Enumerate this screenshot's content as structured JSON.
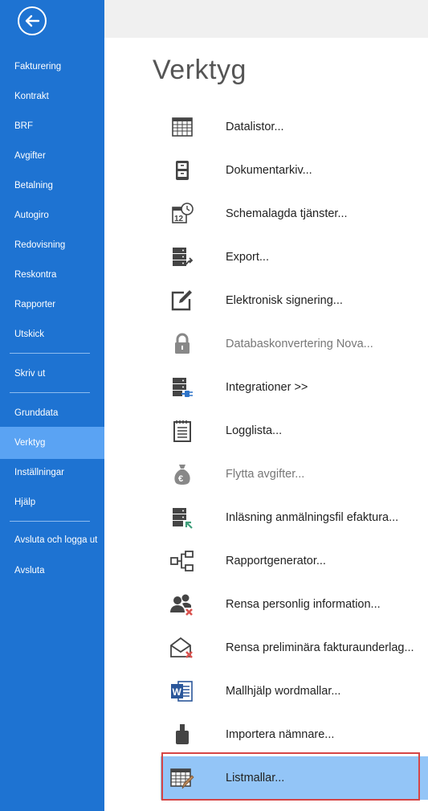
{
  "sidebar": {
    "back_icon": "arrow-left-circle-icon",
    "items": [
      {
        "label": "Fakturering"
      },
      {
        "label": "Kontrakt"
      },
      {
        "label": "BRF"
      },
      {
        "label": "Avgifter"
      },
      {
        "label": "Betalning"
      },
      {
        "label": "Autogiro"
      },
      {
        "label": "Redovisning"
      },
      {
        "label": "Reskontra"
      },
      {
        "label": "Rapporter"
      },
      {
        "label": "Utskick"
      },
      {
        "label": "Skriv ut"
      },
      {
        "label": "Grunddata"
      },
      {
        "label": "Verktyg"
      },
      {
        "label": "Inställningar"
      },
      {
        "label": "Hjälp"
      },
      {
        "label": "Avsluta och logga ut"
      },
      {
        "label": "Avsluta"
      }
    ],
    "active": "Verktyg",
    "colors": {
      "background": "#1e73d2",
      "active": "#5aa3f3"
    }
  },
  "main": {
    "title": "Verktyg",
    "tools": [
      {
        "label": "Datalistor...",
        "icon": "table-grid-icon",
        "enabled": true
      },
      {
        "label": "Dokumentarkiv...",
        "icon": "filing-cabinet-icon",
        "enabled": true
      },
      {
        "label": "Schemalagda tjänster...",
        "icon": "calendar-clock-icon",
        "enabled": true
      },
      {
        "label": "Export...",
        "icon": "server-export-icon",
        "enabled": true
      },
      {
        "label": "Elektronisk signering...",
        "icon": "edit-sign-icon",
        "enabled": true
      },
      {
        "label": "Databaskonvertering Nova...",
        "icon": "lock-icon",
        "enabled": false
      },
      {
        "label": "Integrationer >>",
        "icon": "server-plug-icon",
        "enabled": true
      },
      {
        "label": "Logglista...",
        "icon": "notepad-icon",
        "enabled": true
      },
      {
        "label": "Flytta avgifter...",
        "icon": "money-bag-icon",
        "enabled": false
      },
      {
        "label": "Inläsning anmälningsfil efaktura...",
        "icon": "server-import-icon",
        "enabled": true
      },
      {
        "label": "Rapportgenerator...",
        "icon": "hierarchy-icon",
        "enabled": true
      },
      {
        "label": "Rensa personlig information...",
        "icon": "users-remove-icon",
        "enabled": true
      },
      {
        "label": "Rensa preliminära fakturaunderlag...",
        "icon": "envelope-remove-icon",
        "enabled": true
      },
      {
        "label": "Mallhjälp wordmallar...",
        "icon": "word-document-icon",
        "enabled": true
      },
      {
        "label": "Importera nämnare...",
        "icon": "weight-icon",
        "enabled": true
      },
      {
        "label": "Listmallar...",
        "icon": "table-edit-icon",
        "enabled": true,
        "selected": true
      }
    ],
    "colors": {
      "selected": "#93c5f7",
      "frame": "#d64545"
    }
  }
}
